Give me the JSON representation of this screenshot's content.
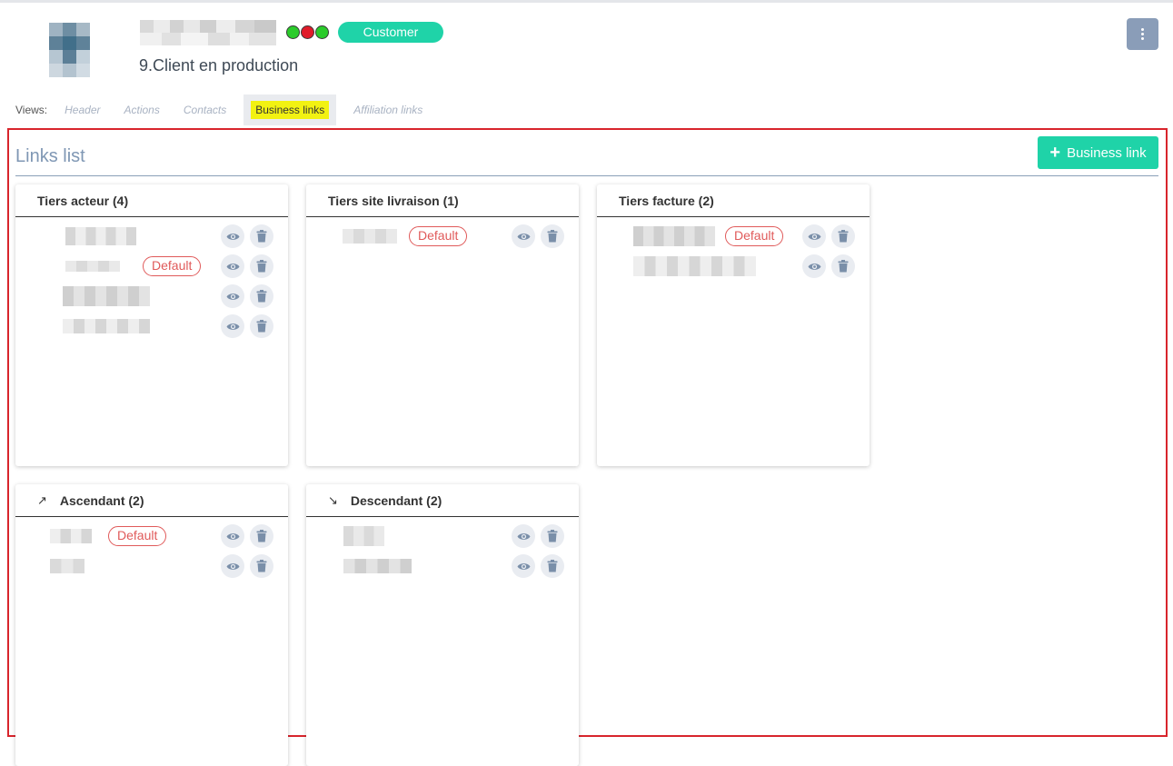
{
  "record": {
    "status_label": "9.Client en production",
    "type_badge": "Customer",
    "indicator_colors": [
      "#2bcb2b",
      "#e01b2a",
      "#2bcb2b"
    ]
  },
  "views": {
    "label": "Views:",
    "tabs": [
      "Header",
      "Actions",
      "Contacts",
      "Business links",
      "Affiliation links"
    ],
    "active_tab": "Business links"
  },
  "links_section": {
    "title": "Links list",
    "add_button_label": "Business link"
  },
  "default_label": "Default",
  "cards": [
    {
      "title": "Tiers acteur (4)",
      "arrow": "",
      "rows": [
        {
          "default": false
        },
        {
          "default": true
        },
        {
          "default": false
        },
        {
          "default": false
        }
      ]
    },
    {
      "title": "Tiers site livraison (1)",
      "arrow": "",
      "rows": [
        {
          "default": true
        }
      ]
    },
    {
      "title": "Tiers facture (2)",
      "arrow": "",
      "rows": [
        {
          "default": true
        },
        {
          "default": false
        }
      ]
    },
    {
      "title": "Ascendant (2)",
      "arrow": "↗",
      "rows": [
        {
          "default": true
        },
        {
          "default": false
        }
      ]
    },
    {
      "title": "Descendant (2)",
      "arrow": "↘",
      "rows": [
        {
          "default": false
        },
        {
          "default": false
        }
      ]
    }
  ],
  "colors": {
    "accent": "#1fd3a8",
    "highlight": "#f2f212",
    "frame": "#d8252c",
    "default_tag": "#e05a5a",
    "menu_button": "#8a9db8"
  }
}
